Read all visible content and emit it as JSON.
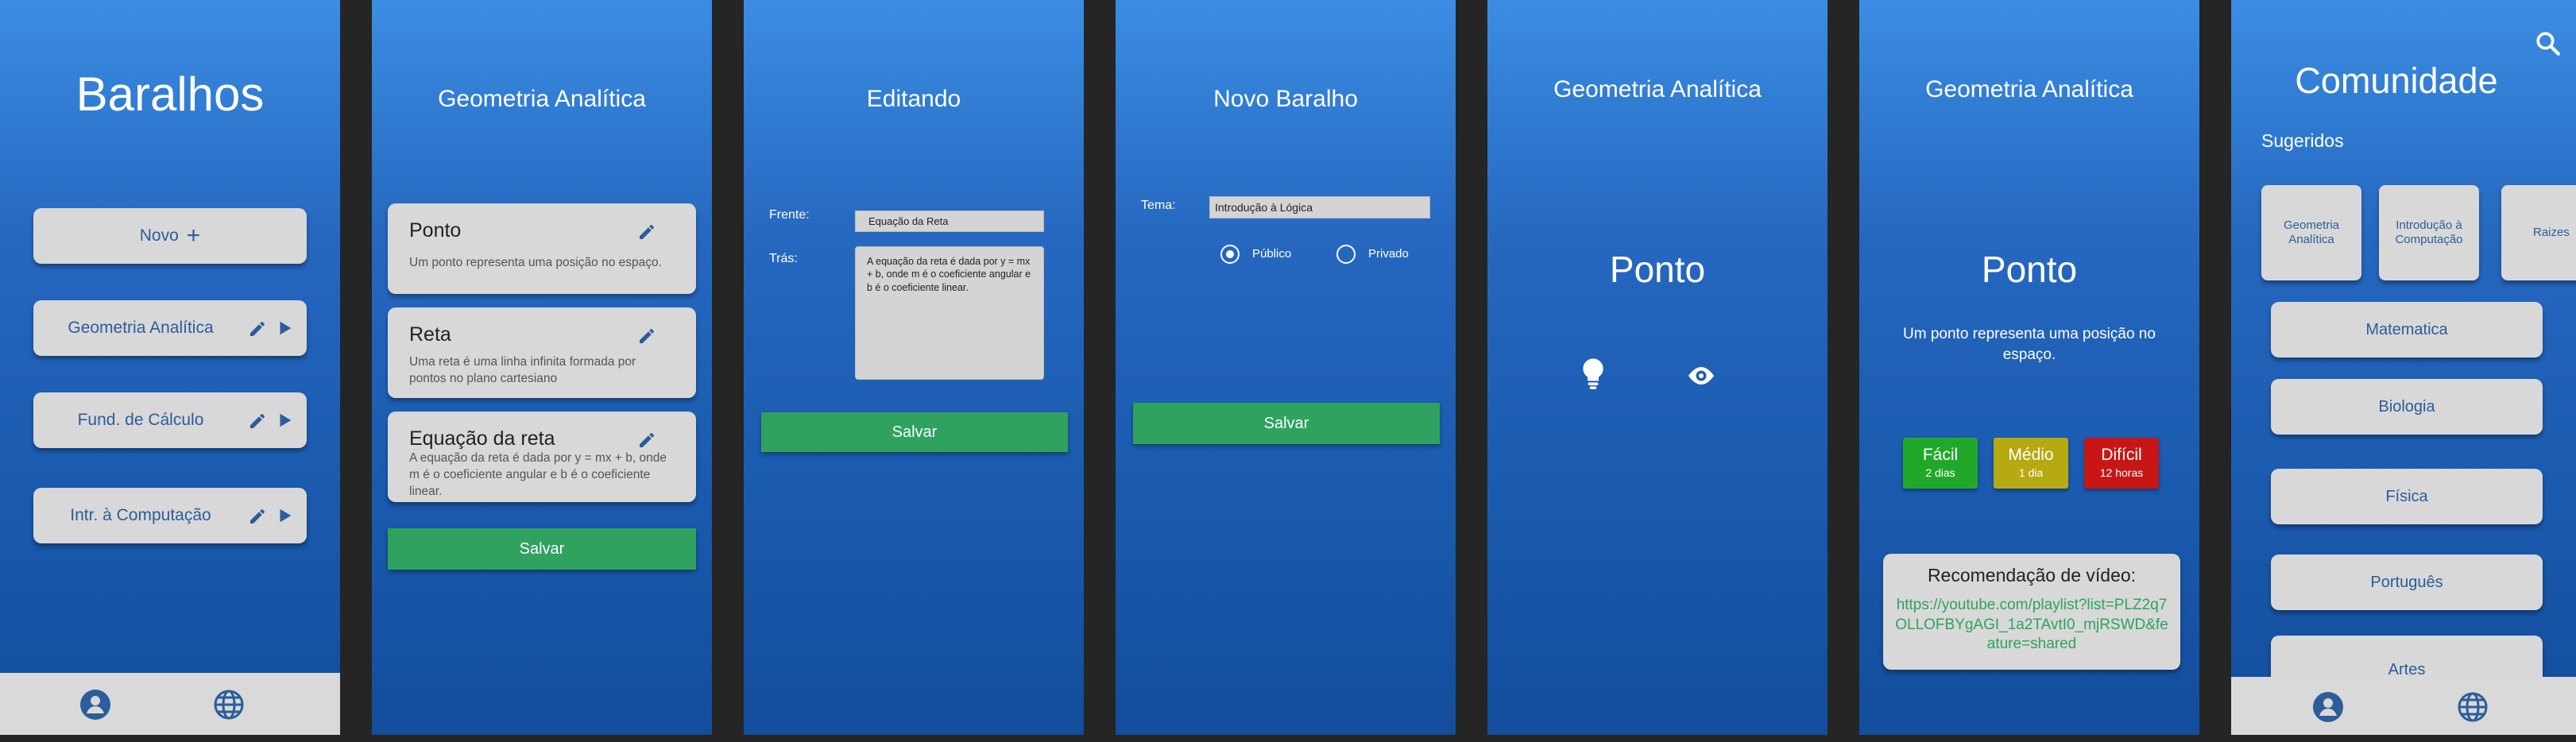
{
  "screen1": {
    "title": "Baralhos",
    "new_label": "Novo",
    "decks": [
      "Geometria Analítica",
      "Fund. de Cálculo",
      "Intr. à Computação"
    ],
    "icons": {
      "edit": "pencil-icon",
      "play": "play-icon",
      "profile": "user-icon",
      "community": "globe-icon"
    }
  },
  "screen2": {
    "title": "Geometria Analítica",
    "cards": [
      {
        "title": "Ponto",
        "body": "Um ponto representa uma posição no espaço."
      },
      {
        "title": "Reta",
        "body": "Uma reta é uma linha infinita formada por pontos no plano cartesiano"
      },
      {
        "title": "Equação da reta",
        "body": "A equação da reta é dada por y = mx + b, onde m é o coeficiente angular e b é o coeficiente linear."
      }
    ],
    "save_label": "Salvar"
  },
  "screen3": {
    "title": "Editando",
    "front_label": "Frente:",
    "front_value": "Equação da Reta",
    "back_label": "Trás:",
    "back_value": "A equação da reta é dada por y = mx + b, onde m é o coeficiente angular e b é o coeficiente linear.",
    "save_label": "Salvar"
  },
  "screen4": {
    "title": "Novo Baralho",
    "theme_label": "Tema:",
    "theme_value": "Introdução à Lógica",
    "public_label": "Público",
    "private_label": "Privado",
    "selected": "Público",
    "save_label": "Salvar"
  },
  "screen5": {
    "title": "Geometria Analítica",
    "card_front": "Ponto",
    "icons": {
      "hint": "lightbulb-icon",
      "reveal": "eye-icon"
    }
  },
  "screen6": {
    "title": "Geometria Analítica",
    "card_front": "Ponto",
    "card_back": "Um ponto representa uma posição no espaço.",
    "difficulty": [
      {
        "label": "Fácil",
        "interval": "2 dias",
        "color": "#21a829"
      },
      {
        "label": "Médio",
        "interval": "1 dia",
        "color": "#b7a912"
      },
      {
        "label": "Difícil",
        "interval": "12 horas",
        "color": "#c81616"
      }
    ],
    "video_title": "Recomendação de vídeo:",
    "video_link": "https://youtube.com/playlist?list=PLZ2q7OLLOFBYgAGI_1a2TAvtI0_mjRSWD&feature=shared"
  },
  "screen7": {
    "title": "Comunidade",
    "suggested_label": "Sugeridos",
    "suggested": [
      "Geometria Analítica",
      "Introdução à Computação",
      "Raizes"
    ],
    "subjects": [
      "Matematica",
      "Biologia",
      "Física",
      "Português",
      "Artes"
    ],
    "icons": {
      "search": "search-icon",
      "profile": "user-icon",
      "community": "globe-icon"
    }
  },
  "colors": {
    "save": "#2ea25e",
    "card": "#d8d8d8",
    "link": "#2ea25e"
  }
}
